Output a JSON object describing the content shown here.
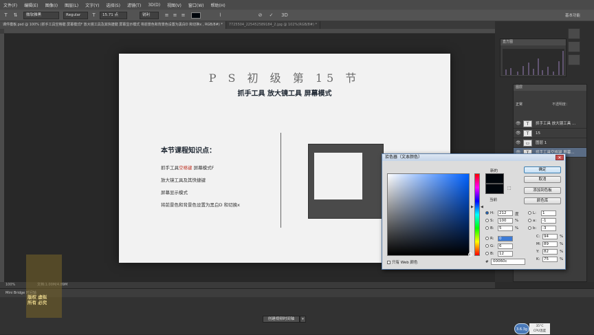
{
  "menu": [
    "文件(F)",
    "编辑(E)",
    "图像(I)",
    "图层(L)",
    "文字(Y)",
    "选择(S)",
    "滤镜(T)",
    "3D(D)",
    "视图(V)",
    "窗口(W)",
    "帮助(H)"
  ],
  "options": {
    "font_family": "微软雅黑",
    "font_style": "Regular",
    "font_size": "15.71 点",
    "antialias": "锐利",
    "workspace": "基本功能"
  },
  "tabs": [
    "课件模板.psd @ 100% (抓手工具空格键  屏幕模式F  放大镜工具及其快捷键 屏幕显示模式 将前景色和背景色设置为黑白D 和切换x , RGB/8#) *",
    "7725504_225452589184_2.jpg @ 102%(RGB/8#) *"
  ],
  "document": {
    "title": "P S 初 级 第 15 节",
    "subtitle": "抓手工具 放大镜工具 屏幕模式",
    "heading": "本节课程知识点：",
    "points": [
      {
        "pre": "抓手工具",
        "red": "空格键",
        "post": "  屏幕模式F"
      },
      {
        "pre": "放大镜工具及其快捷键",
        "red": "",
        "post": ""
      },
      {
        "pre": "屏幕显示模式",
        "red": "",
        "post": ""
      },
      {
        "pre": "将前景色和背景色设置为黑白D  和切换x",
        "red": "",
        "post": ""
      }
    ]
  },
  "panels": {
    "histogram_title": "直方图",
    "layers_title": "图层",
    "blend_mode": "正常",
    "opacity_label": "不透明度：",
    "layers": [
      {
        "type": "T",
        "name": "抓手工具 放大镜工具 ...",
        "selected": false
      },
      {
        "type": "T",
        "name": "15",
        "selected": false
      },
      {
        "type": "▭",
        "name": "图层 1",
        "selected": false
      },
      {
        "type": "T",
        "name": "抓手工具空格键  屏幕...",
        "selected": true
      }
    ]
  },
  "status": {
    "zoom": "100%",
    "doc_size": "文档:1.00M/4.89M"
  },
  "timeline": {
    "tabs": "Mini Bridge   时间轴",
    "create_button": "创建视频时间轴"
  },
  "picker": {
    "title": "拾色器（文本颜色）",
    "new_label": "新的",
    "current_label": "当前",
    "buttons": [
      "确定",
      "取消",
      "添加到色板",
      "颜色库"
    ],
    "hsb": [
      {
        "label": "H:",
        "value": "212",
        "unit": "度"
      },
      {
        "label": "S:",
        "value": "100",
        "unit": "%"
      },
      {
        "label": "B:",
        "value": "5",
        "unit": "%"
      }
    ],
    "rgb": [
      {
        "label": "R:",
        "value": "0"
      },
      {
        "label": "G:",
        "value": "6"
      },
      {
        "label": "B:",
        "value": "12"
      }
    ],
    "lab": [
      {
        "label": "L:",
        "value": "1"
      },
      {
        "label": "a:",
        "value": "-1"
      },
      {
        "label": "b:",
        "value": "-3"
      }
    ],
    "cmyk": [
      {
        "label": "C:",
        "value": "94",
        "unit": "%"
      },
      {
        "label": "M:",
        "value": "89",
        "unit": "%"
      },
      {
        "label": "Y:",
        "value": "82",
        "unit": "%"
      },
      {
        "label": "K:",
        "value": "75",
        "unit": "%"
      }
    ],
    "web_only": "只有 Web 颜色",
    "hex": "00060c",
    "color": "#00060c"
  },
  "watermark": {
    "line1": "版权  虚拟",
    "line2": "所有  必究"
  },
  "cpu": {
    "badge": "3.6.3g",
    "temp": "35°C",
    "label": "CPU温度"
  }
}
